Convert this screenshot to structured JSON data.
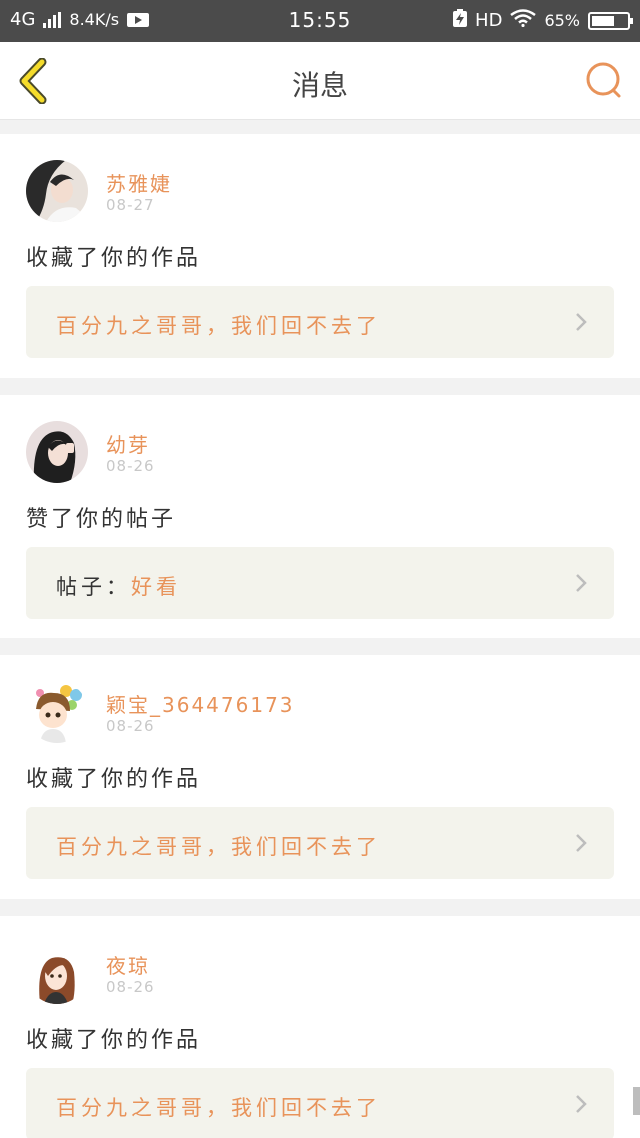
{
  "status_bar": {
    "network": "4G",
    "speed": "8.4K/s",
    "time": "15:55",
    "hd": "HD",
    "battery": "65%",
    "battery_level": 0.65
  },
  "nav": {
    "title": "消息",
    "accent_color": "#e8935a"
  },
  "messages": [
    {
      "username": "苏雅婕",
      "date": "08-27",
      "action": "收藏了你的作品",
      "quote_label": "",
      "quote_text": "百分九之哥哥，我们回不去了"
    },
    {
      "username": "幼芽",
      "date": "08-26",
      "action": "赞了你的帖子",
      "quote_label": "帖子：",
      "quote_text": "好看"
    },
    {
      "username": "颖宝_364476173",
      "date": "08-26",
      "action": "收藏了你的作品",
      "quote_label": "",
      "quote_text": "百分九之哥哥，我们回不去了"
    },
    {
      "username": "夜琼",
      "date": "08-26",
      "action": "收藏了你的作品",
      "quote_label": "",
      "quote_text": "百分九之哥哥，我们回不去了"
    }
  ]
}
